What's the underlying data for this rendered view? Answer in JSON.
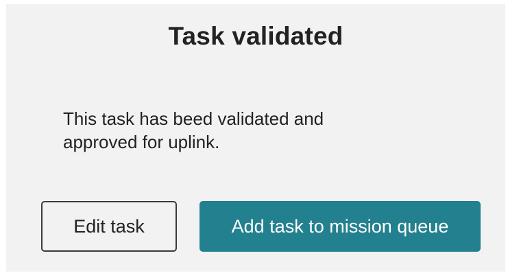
{
  "dialog": {
    "title": "Task validated",
    "message": "This task has beed validated and approved for uplink.",
    "buttons": {
      "edit_label": "Edit task",
      "add_label": "Add task to mission queue"
    }
  },
  "colors": {
    "dialog_background": "#f2f2f2",
    "primary_button": "#23808f",
    "text": "#222222"
  }
}
